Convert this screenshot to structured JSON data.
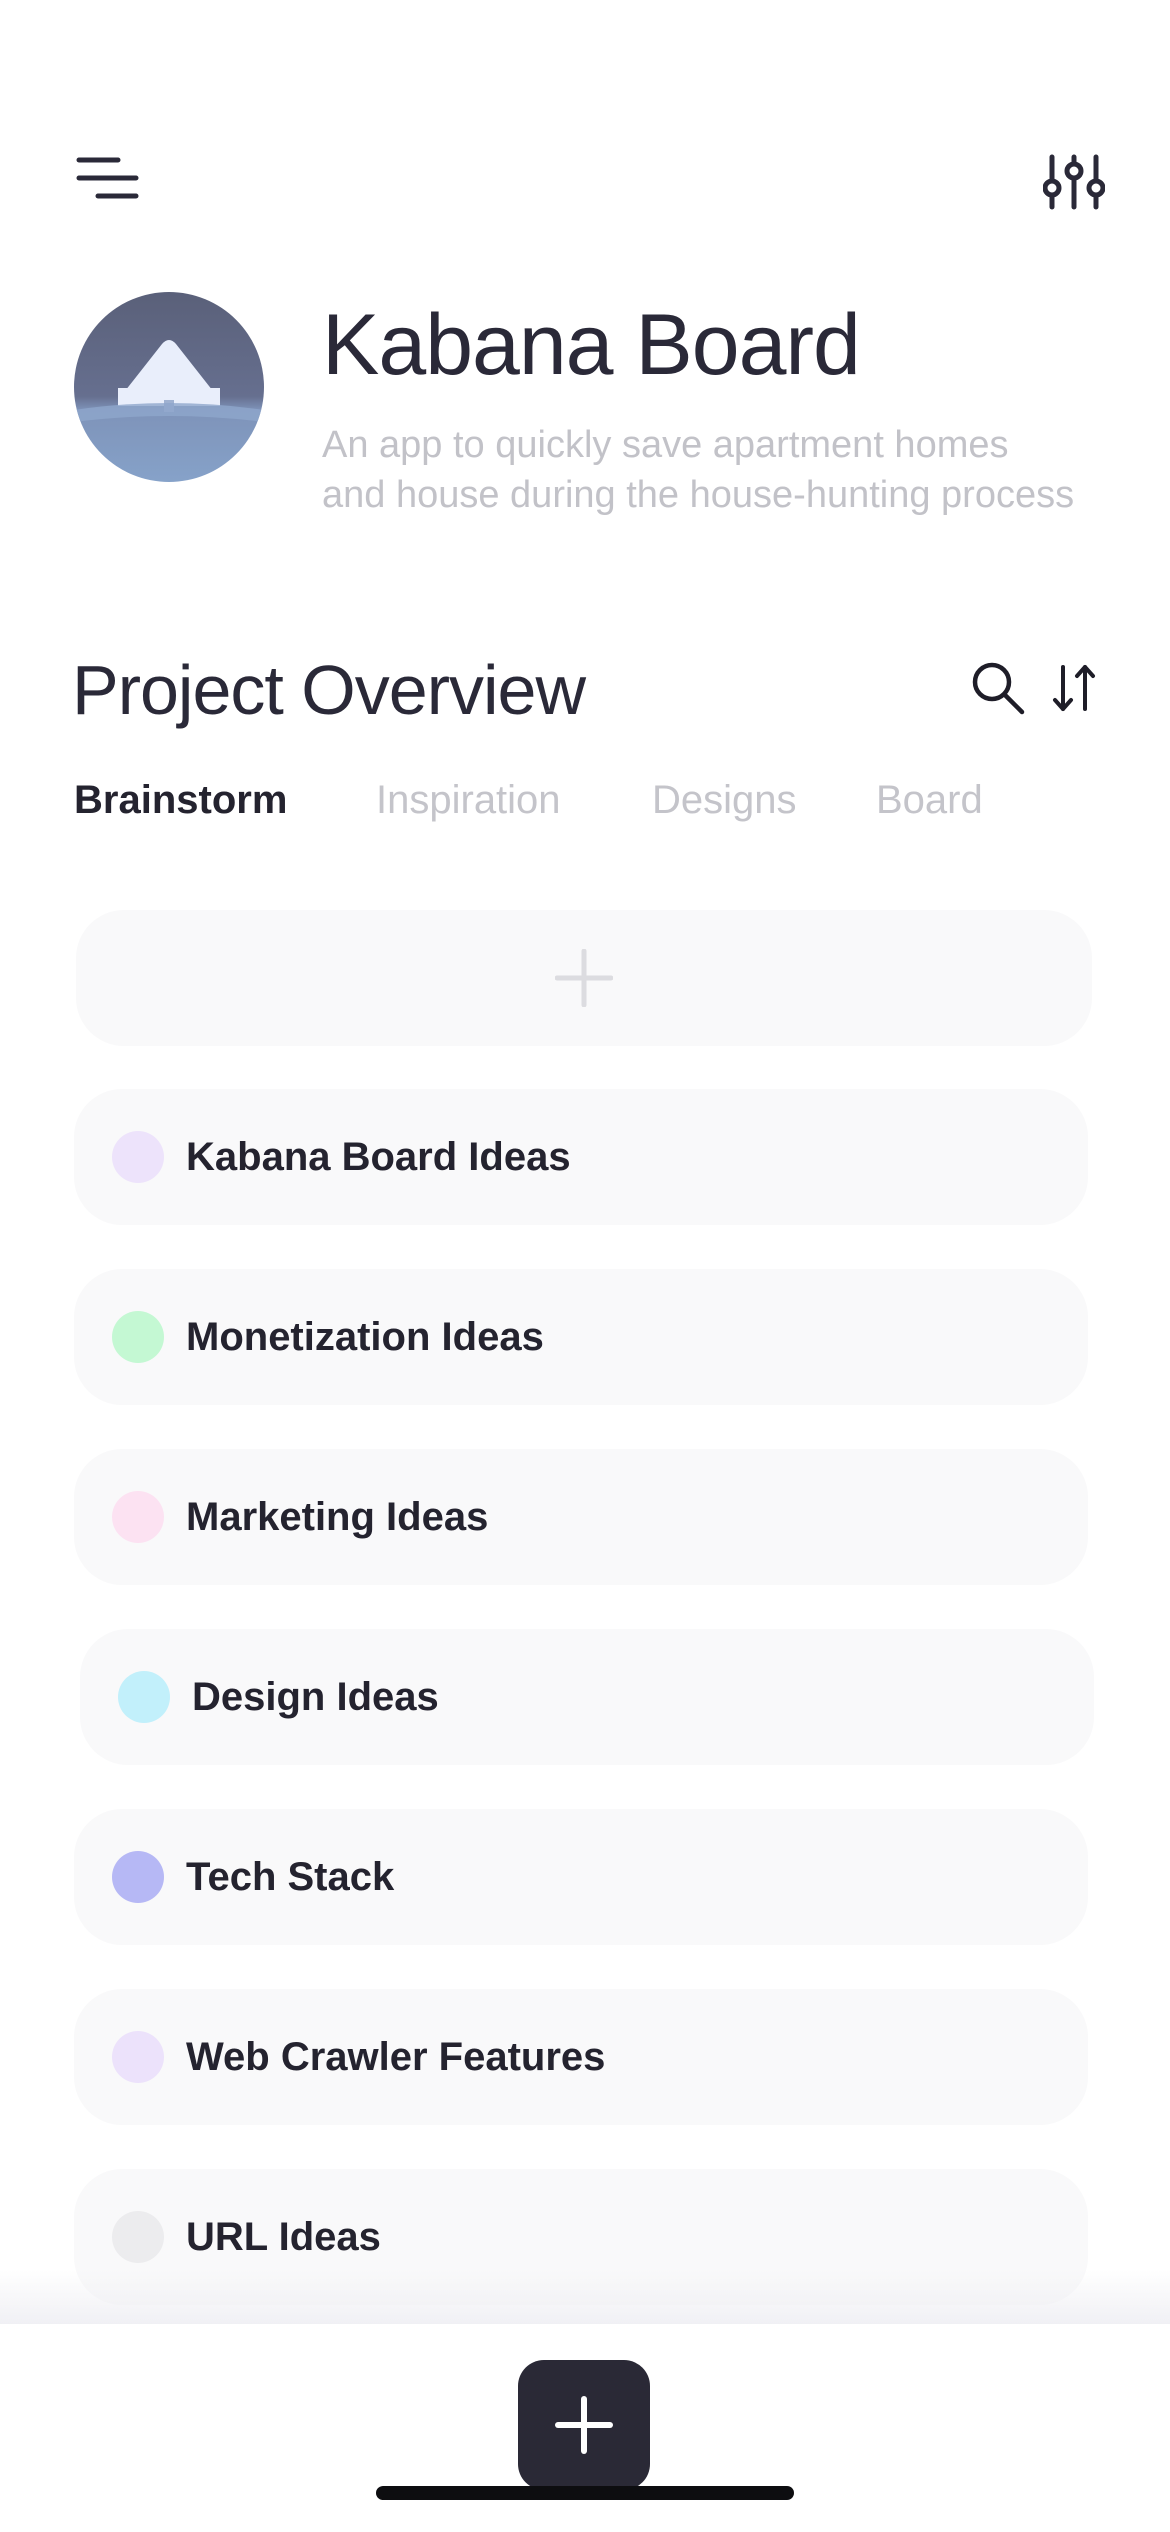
{
  "project": {
    "title": "Kabana Board",
    "description": "An app to quickly save apartment homes and house during the house-hunting process"
  },
  "section": {
    "title": "Project Overview"
  },
  "tabs": [
    {
      "label": "Brainstorm",
      "active": true
    },
    {
      "label": "Inspiration",
      "active": false
    },
    {
      "label": "Designs",
      "active": false
    },
    {
      "label": "Board",
      "active": false
    }
  ],
  "items": [
    {
      "label": "Kabana Board Ideas",
      "color": "#ede3fb"
    },
    {
      "label": "Monetization Ideas",
      "color": "#c4f8d3"
    },
    {
      "label": "Marketing Ideas",
      "color": "#fce2f2"
    },
    {
      "label": "Design Ideas",
      "color": "#c2f0fb"
    },
    {
      "label": "Tech Stack",
      "color": "#b6b8f5"
    },
    {
      "label": "Web Crawler Features",
      "color": "#ece2fb"
    },
    {
      "label": "URL Ideas",
      "color": "#ececee"
    }
  ],
  "icons": {
    "menu": "menu-icon",
    "filter": "sliders-icon",
    "search": "search-icon",
    "sort": "sort-icon",
    "add_card": "plus-icon",
    "fab": "plus-icon"
  },
  "colors": {
    "text_dark": "#272733",
    "text_muted": "#c2c2c8",
    "card_bg": "#f9f9fa",
    "fab_bg": "#2a2936"
  }
}
